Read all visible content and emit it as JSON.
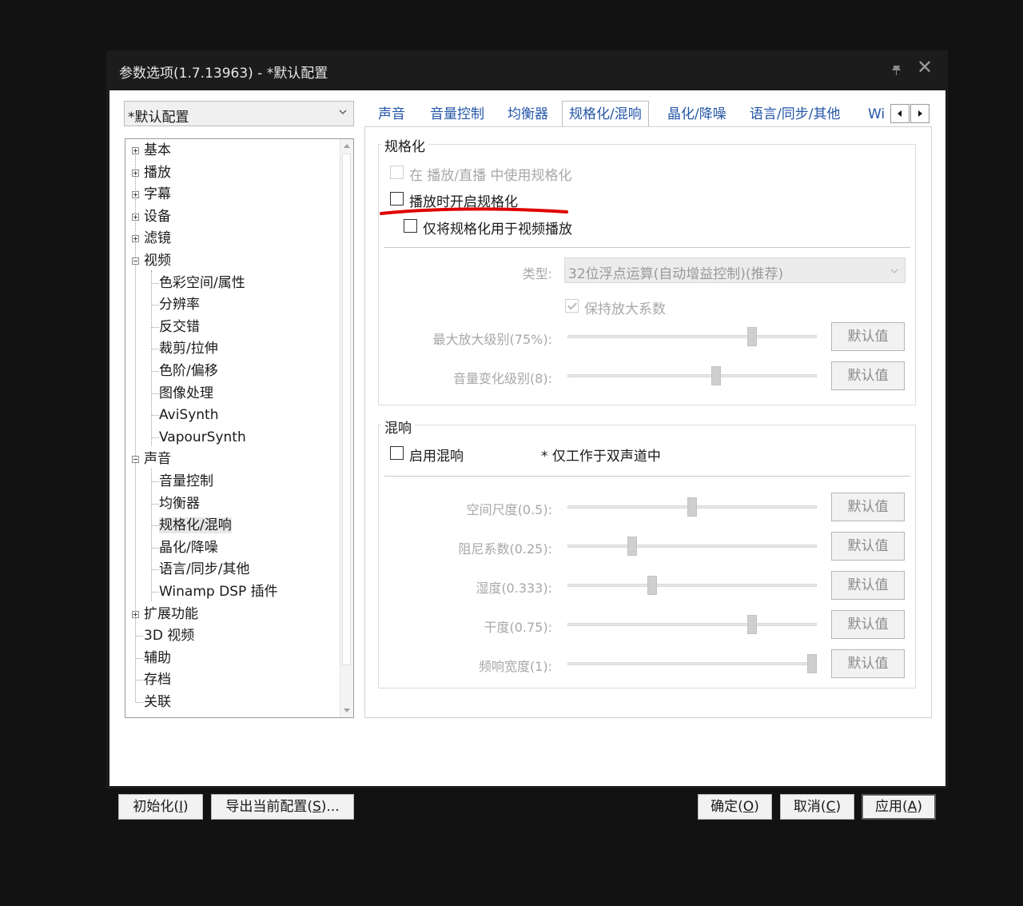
{
  "window": {
    "title": "参数选项(1.7.13963) - *默认配置"
  },
  "profile": {
    "selected": "*默认配置"
  },
  "tree": {
    "items": [
      {
        "label": "基本"
      },
      {
        "label": "播放"
      },
      {
        "label": "字幕"
      },
      {
        "label": "设备"
      },
      {
        "label": "滤镜"
      },
      {
        "label": "视频"
      },
      {
        "label": "色彩空间/属性"
      },
      {
        "label": "分辨率"
      },
      {
        "label": "反交错"
      },
      {
        "label": "裁剪/拉伸"
      },
      {
        "label": "色阶/偏移"
      },
      {
        "label": "图像处理"
      },
      {
        "label": "AviSynth"
      },
      {
        "label": "VapourSynth"
      },
      {
        "label": "声音"
      },
      {
        "label": "音量控制"
      },
      {
        "label": "均衡器"
      },
      {
        "label": "规格化/混响"
      },
      {
        "label": "晶化/降噪"
      },
      {
        "label": "语言/同步/其他"
      },
      {
        "label": "Winamp DSP 插件"
      },
      {
        "label": "扩展功能"
      },
      {
        "label": "3D 视频"
      },
      {
        "label": "辅助"
      },
      {
        "label": "存档"
      },
      {
        "label": "关联"
      }
    ]
  },
  "tabs": [
    {
      "label": "声音"
    },
    {
      "label": "音量控制"
    },
    {
      "label": "均衡器"
    },
    {
      "label": "规格化/混响"
    },
    {
      "label": "晶化/降噪"
    },
    {
      "label": "语言/同步/其他"
    },
    {
      "label": "Wi"
    }
  ],
  "normalize": {
    "title": "规格化",
    "cb_live": "在 播放/直播 中使用规格化",
    "cb_on_play": "播放时开启规格化",
    "cb_video_only": "仅将规格化用于视频播放",
    "type_label": "类型:",
    "type_value": "32位浮点运算(自动增益控制)(推荐)",
    "keep_gain": "保持放大系数",
    "sliders": [
      {
        "label": "最大放大级别(75%):",
        "value": 0.75
      },
      {
        "label": "音量变化级别(8):",
        "value": 0.6
      }
    ]
  },
  "reverb": {
    "title": "混响",
    "cb_enable": "启用混响",
    "note": "* 仅工作于双声道中",
    "sliders": [
      {
        "label": "空间尺度(0.5):",
        "value": 0.5
      },
      {
        "label": "阻尼系数(0.25):",
        "value": 0.25
      },
      {
        "label": "湿度(0.333):",
        "value": 0.333
      },
      {
        "label": "干度(0.75):",
        "value": 0.75
      },
      {
        "label": "频响宽度(1):",
        "value": 1.0
      }
    ]
  },
  "default_btn": "默认值",
  "footer": {
    "init": {
      "text": "初始化(",
      "key": "I",
      "end": ")"
    },
    "export": {
      "text": "导出当前配置(",
      "key": "S",
      "end": ")..."
    },
    "ok": {
      "text": "确定(",
      "key": "O",
      "end": ")"
    },
    "cancel": {
      "text": "取消(",
      "key": "C",
      "end": ")"
    },
    "apply": {
      "text": "应用(",
      "key": "A",
      "end": ")"
    }
  }
}
